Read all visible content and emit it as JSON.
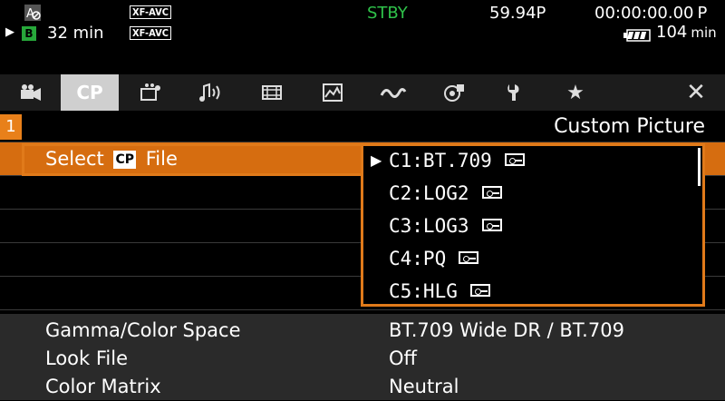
{
  "status": {
    "media_remaining": "32 min",
    "slot": "B",
    "codec_top": "XF-AVC",
    "codec_bottom": "XF-AVC",
    "mode": "STBY",
    "frame_rate": "59.94P",
    "timecode": "00:00:00.00",
    "timecode_mode": "P",
    "battery": "104",
    "battery_unit": "min"
  },
  "tabs": [
    {
      "name": "camera",
      "icon": "movie-camera-icon"
    },
    {
      "name": "custom-picture",
      "label": "CP",
      "icon": "cp-icon",
      "active": true
    },
    {
      "name": "recording",
      "icon": "recording-setup-icon"
    },
    {
      "name": "audio",
      "icon": "audio-icon"
    },
    {
      "name": "video",
      "icon": "film-icon"
    },
    {
      "name": "display",
      "icon": "display-icon"
    },
    {
      "name": "system-assist",
      "icon": "wave-icon"
    },
    {
      "name": "network",
      "icon": "network-icon"
    },
    {
      "name": "settings",
      "icon": "wrench-icon"
    },
    {
      "name": "my-menu",
      "icon": "star-icon"
    },
    {
      "name": "close",
      "icon": "close-icon"
    }
  ],
  "page": {
    "number": "1",
    "title": "Custom Picture"
  },
  "menu": {
    "select_label_pre": "Select",
    "select_badge": "CP",
    "select_label_post": "File"
  },
  "options": [
    {
      "label": "C1:BT.709",
      "selected": true
    },
    {
      "label": "C2:LOG2"
    },
    {
      "label": "C3:LOG3"
    },
    {
      "label": "C4:PQ"
    },
    {
      "label": "C5:HLG"
    }
  ],
  "details": [
    {
      "key": "Gamma/Color Space",
      "value": "BT.709 Wide DR / BT.709"
    },
    {
      "key": "Look File",
      "value": "Off"
    },
    {
      "key": "Color Matrix",
      "value": "Neutral"
    }
  ]
}
